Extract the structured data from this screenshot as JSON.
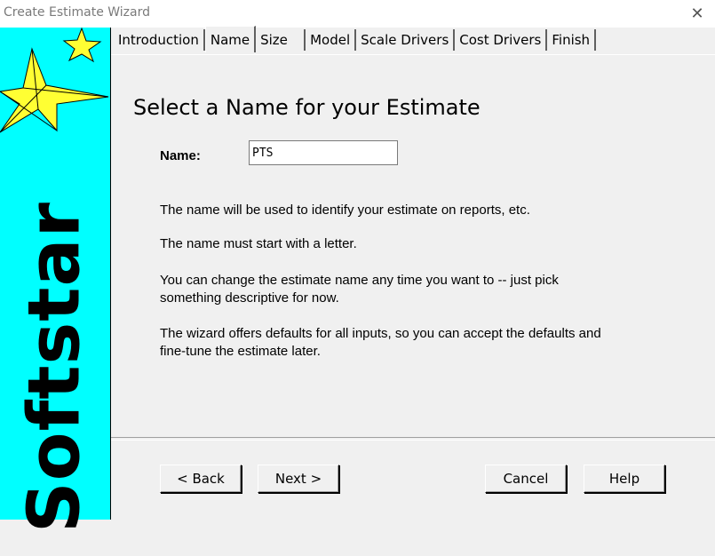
{
  "window": {
    "title": "Create Estimate Wizard"
  },
  "sidebar": {
    "brand": "Softstar",
    "logo_colors": {
      "background": "#00ffff",
      "star": "#ffff33"
    }
  },
  "tabs": [
    {
      "label": "Introduction"
    },
    {
      "label": "Name",
      "active": true
    },
    {
      "label": "Size"
    },
    {
      "label": "Model"
    },
    {
      "label": "Scale Drivers"
    },
    {
      "label": "Cost Drivers"
    },
    {
      "label": "Finish"
    }
  ],
  "page": {
    "heading": "Select a Name for your Estimate",
    "name_label": "Name:",
    "name_value": "PTS",
    "paragraphs": [
      "The name will be used to identify your estimate on reports, etc.",
      "The name must start with a letter.",
      "You can change the estimate name any time you want to -- just pick something descriptive for now.",
      "The wizard offers defaults for all inputs, so you can accept the defaults and fine-tune the estimate later."
    ]
  },
  "buttons": {
    "back": "< Back",
    "next": "Next >",
    "cancel": "Cancel",
    "help": "Help"
  }
}
